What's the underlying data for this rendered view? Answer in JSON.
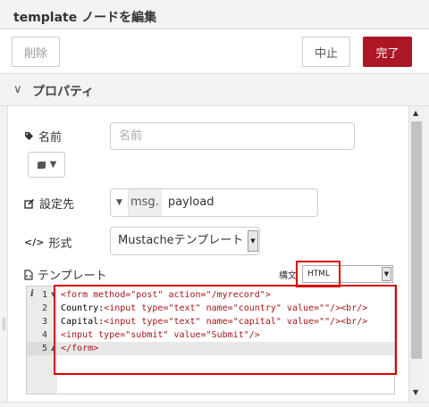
{
  "window": {
    "title": "template ノードを編集"
  },
  "toolbar": {
    "delete_label": "削除",
    "cancel_label": "中止",
    "done_label": "完了"
  },
  "section": {
    "chevron": "∨",
    "title": "プロパティ"
  },
  "form": {
    "name": {
      "label": "名前",
      "placeholder": "名前",
      "value": ""
    },
    "property": {
      "label": "設定先",
      "prefix": "msg.",
      "value": "payload"
    },
    "format": {
      "label": "形式",
      "value": "Mustacheテンプレート"
    },
    "template": {
      "label": "テンプレート",
      "syntax_label": "構文",
      "syntax_value": "HTML"
    }
  },
  "editor": {
    "line_numbers": [
      "1",
      "2",
      "3",
      "4",
      "5"
    ],
    "active_line": 5,
    "lines": [
      [
        [
          "tag",
          "<form "
        ],
        [
          "attr",
          "method="
        ],
        [
          "str",
          "\"post\""
        ],
        [
          "txt",
          " "
        ],
        [
          "attr",
          "action="
        ],
        [
          "str",
          "\"/myrecord\""
        ],
        [
          "tag",
          ">"
        ]
      ],
      [
        [
          "txt",
          "Country:"
        ],
        [
          "tag",
          "<input "
        ],
        [
          "attr",
          "type="
        ],
        [
          "str",
          "\"text\""
        ],
        [
          "txt",
          " "
        ],
        [
          "attr",
          "name="
        ],
        [
          "str",
          "\"country\""
        ],
        [
          "txt",
          " "
        ],
        [
          "attr",
          "value="
        ],
        [
          "str",
          "\"\""
        ],
        [
          "tag",
          "/>"
        ],
        [
          "tag",
          "<br/>"
        ]
      ],
      [
        [
          "txt",
          "Capital:"
        ],
        [
          "tag",
          "<input "
        ],
        [
          "attr",
          "type="
        ],
        [
          "str",
          "\"text\""
        ],
        [
          "txt",
          " "
        ],
        [
          "attr",
          "name="
        ],
        [
          "str",
          "\"capital\""
        ],
        [
          "txt",
          " "
        ],
        [
          "attr",
          "value="
        ],
        [
          "str",
          "\"\""
        ],
        [
          "tag",
          "/>"
        ],
        [
          "tag",
          "<br/>"
        ]
      ],
      [
        [
          "tag",
          "<input "
        ],
        [
          "attr",
          "type="
        ],
        [
          "str",
          "\"submit\""
        ],
        [
          "txt",
          " "
        ],
        [
          "attr",
          "value="
        ],
        [
          "str",
          "\"Submit\""
        ],
        [
          "tag",
          "/>"
        ]
      ],
      [
        [
          "tag",
          "</form>"
        ]
      ]
    ]
  },
  "colors": {
    "done_button": "#ad1625",
    "highlight": "#e00000"
  },
  "icons": {
    "name": "tag-icon",
    "icon_picker": "book-icon",
    "property": "edit-icon",
    "format": "code-icon",
    "template": "file-code-icon",
    "editor_info": "info-icon"
  }
}
